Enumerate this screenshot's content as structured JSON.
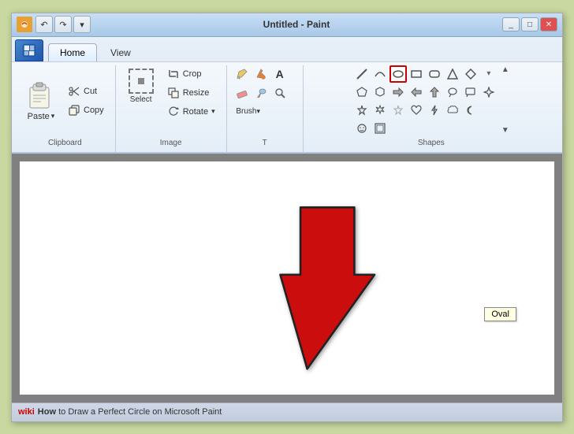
{
  "window": {
    "title": "Untitled - Paint",
    "icon_label": "P"
  },
  "tabs": {
    "home": "Home",
    "view": "View"
  },
  "groups": {
    "clipboard": {
      "label": "Clipboard",
      "paste": "Paste",
      "cut": "Cut",
      "copy": "Copy"
    },
    "image": {
      "label": "Image",
      "crop": "Crop",
      "resize": "Resize",
      "rotate": "Rotate",
      "select": "Select"
    },
    "tools": {
      "label": "T"
    },
    "shapes": {
      "label": "Shapes",
      "oval_tooltip": "Oval"
    }
  },
  "statusbar": {
    "wiki": "wiki",
    "how_text": "How to Draw a Perfect Circle on Microsoft Paint"
  },
  "colors": {
    "accent": "#cc0000",
    "highlight_border": "#cc0000",
    "ribbon_bg": "#ddeeff",
    "canvas_bg": "#808080"
  }
}
